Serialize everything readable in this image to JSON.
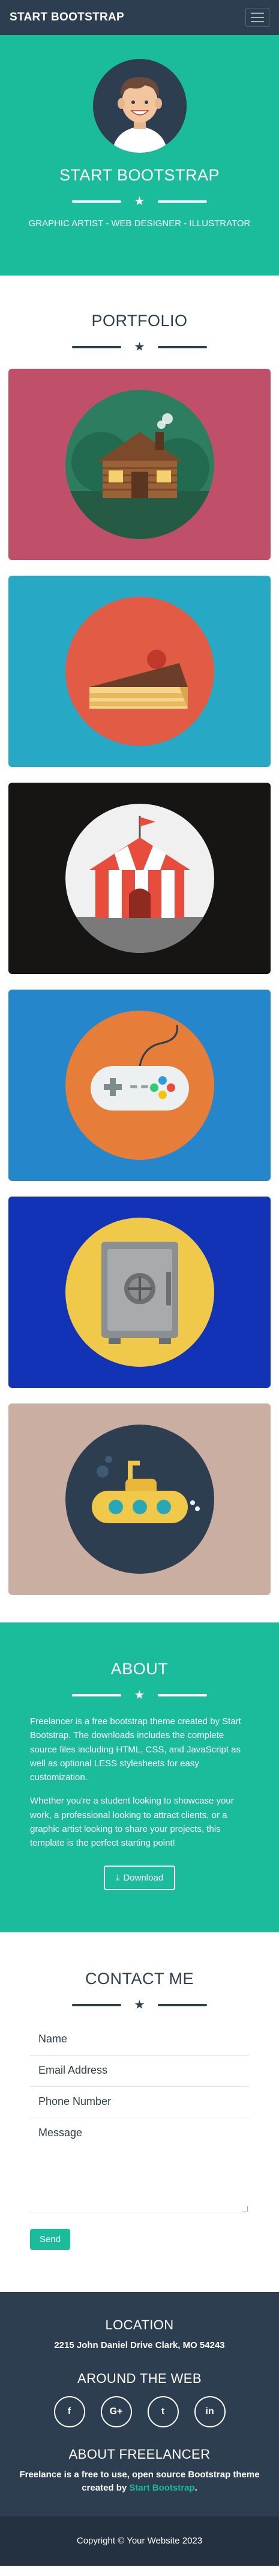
{
  "navbar": {
    "brand": "START BOOTSTRAP",
    "menu_icon": "hamburger-menu-icon"
  },
  "header": {
    "title": "START BOOTSTRAP",
    "divider_icon": "star-icon",
    "tagline": "GRAPHIC ARTIST - WEB DESIGNER - ILLUSTRATOR",
    "avatar_icon": "avatar-illustration-icon"
  },
  "portfolio": {
    "title": "PORTFOLIO",
    "items": [
      {
        "icon": "cabin-icon",
        "background": "#c0506a"
      },
      {
        "icon": "cake-icon",
        "background": "#27a9c6"
      },
      {
        "icon": "circus-tent-icon",
        "background": "#171414"
      },
      {
        "icon": "game-controller-icon",
        "background": "#2586cb"
      },
      {
        "icon": "safe-icon",
        "background": "#1233b6"
      },
      {
        "icon": "submarine-icon",
        "background": "#c9aea1"
      }
    ]
  },
  "about": {
    "title": "ABOUT",
    "paragraph_1": "Freelancer is a free bootstrap theme created by Start Bootstrap. The downloads includes the complete source files including HTML, CSS, and JavaScript as well as optional LESS stylesheets for easy customization.",
    "paragraph_2": "Whether you're a student looking to showcase your work, a professional looking to attract clients, or a graphic artist looking to share your projects, this template is the perfect starting point!",
    "download_label": "Download",
    "download_icon": "download-icon"
  },
  "contact": {
    "title": "CONTACT ME",
    "name_placeholder": "Name",
    "email_placeholder": "Email Address",
    "phone_placeholder": "Phone Number",
    "message_placeholder": "Message",
    "send_label": "Send"
  },
  "footer": {
    "location_title": "LOCATION",
    "address": "2215 John Daniel Drive Clark, MO 54243",
    "web_title": "AROUND THE WEB",
    "socials": [
      {
        "label": "f",
        "icon": "facebook-icon"
      },
      {
        "label": "G+",
        "icon": "google-plus-icon"
      },
      {
        "label": "t",
        "icon": "twitter-icon"
      },
      {
        "label": "in",
        "icon": "linkedin-icon"
      }
    ],
    "about_title": "ABOUT FREELANCER",
    "about_text": "Freelance is a free to use, open source Bootstrap theme created by",
    "about_link": "Start Bootstrap",
    "about_end": ".",
    "copyright": "Copyright © Your Website 2023"
  },
  "colors": {
    "primary": "#1abc9c",
    "dark": "#2c3e50",
    "white": "#ffffff"
  }
}
